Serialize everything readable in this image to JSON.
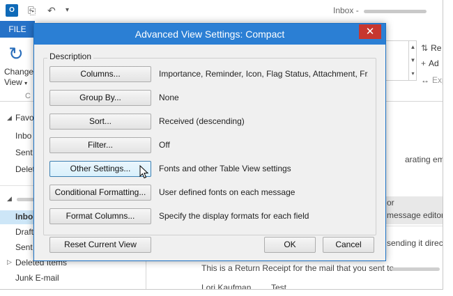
{
  "outlook": {
    "app_icon": "outlook-icon",
    "window_title": "Inbox -",
    "file_tab": "FILE",
    "ribbon": {
      "change_view_label_1": "Change",
      "change_view_label_2": "View",
      "group_initial": "C",
      "right_items": [
        "Re",
        "Ad",
        "Exp"
      ]
    },
    "folder_pane": {
      "favorites": "Favo",
      "fav_items": [
        "Inbo",
        "Sent",
        "Delet"
      ],
      "items": [
        "Inbo",
        "Draft",
        "Sent",
        "Deleted Items",
        "Junk E-mail"
      ]
    },
    "reading_pane": {
      "snippet_1": "arating emails in",
      "snippet_2": "or",
      "snippet_3": "message editor",
      "snippet_4": "sending it direct",
      "receipt": "This is a Return Receipt for the mail that you sent to",
      "from": "Lori Kaufman",
      "subject": "Test"
    }
  },
  "dialog": {
    "title": "Advanced View Settings: Compact",
    "close_glyph": "✕",
    "group_label": "Description",
    "rows": [
      {
        "button": "Columns...",
        "description": "Importance, Reminder, Icon, Flag Status, Attachment, Fr..."
      },
      {
        "button": "Group By...",
        "description": "None"
      },
      {
        "button": "Sort...",
        "description": "Received (descending)"
      },
      {
        "button": "Filter...",
        "description": "Off"
      },
      {
        "button": "Other Settings...",
        "description": "Fonts and other Table View settings"
      },
      {
        "button": "Conditional Formatting...",
        "description": "User defined fonts on each message"
      },
      {
        "button": "Format Columns...",
        "description": "Specify the display formats for each field"
      }
    ],
    "reset_button": "Reset Current View",
    "ok_button": "OK",
    "cancel_button": "Cancel"
  }
}
